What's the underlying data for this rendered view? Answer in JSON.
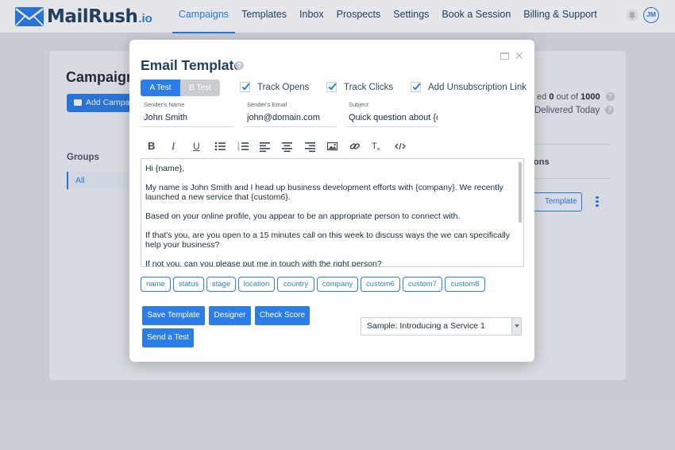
{
  "app": {
    "logo_text": "MailRush",
    "logo_suffix": ".io"
  },
  "nav": {
    "items": [
      {
        "label": "Campaigns",
        "active": true
      },
      {
        "label": "Templates"
      },
      {
        "label": "Inbox"
      },
      {
        "label": "Prospects"
      },
      {
        "label": "Settings"
      },
      {
        "label": "Book a Session"
      },
      {
        "label": "Billing & Support"
      }
    ],
    "avatar_initials": "JM"
  },
  "background": {
    "title": "Campaign",
    "add_button": "Add Campaign",
    "groups_label": "Groups",
    "groups_all": "All",
    "stat_prefix": "ed",
    "stat_value": "0",
    "stat_suffix": "out of",
    "stat_total": "1000",
    "delivered_label": "Delivered Today",
    "table_header": "ons",
    "template_button": "Template"
  },
  "modal": {
    "title": "Email Template",
    "ab_tabs": {
      "a": "A Test",
      "b": "B Test"
    },
    "checkboxes": {
      "track_opens": {
        "label": "Track Opens",
        "checked": true
      },
      "track_clicks": {
        "label": "Track Clicks",
        "checked": true
      },
      "unsub_link": {
        "label": "Add Unsubscription Link",
        "checked": true
      }
    },
    "fields": {
      "sender_name": {
        "label": "Sender's Name",
        "value": "John Smith"
      },
      "sender_email": {
        "label": "Sender's Email",
        "value": "john@domain.com"
      },
      "subject": {
        "label": "Subject",
        "value": "Quick question about {company}"
      }
    },
    "toolbar": {
      "bold": "B",
      "italic": "I",
      "underline": "U",
      "clear_format": "T"
    },
    "body": {
      "line1": "Hi {name},",
      "line2": "My name is John Smith and I head up business development efforts with {company}. We recently launched a new service that {custom6}.",
      "line3": "Based on your online profile, you appear to be an appropriate person to connect with.",
      "line4": "If that's you, are you open to a 15 minutes call on this week to discuss ways the we can specifically help your business?",
      "line5": "If not you, can you please put me in touch with the right person?"
    },
    "tags": [
      "name",
      "status",
      "stage",
      "location",
      "country",
      "company",
      "custom6",
      "custom7",
      "custom8"
    ],
    "buttons": {
      "save": "Save Template",
      "designer": "Designer",
      "check": "Check Score",
      "send_test": "Send a Test"
    },
    "sample_select": "Sample: Introducing a Service 1"
  },
  "colors": {
    "accent": "#2b7de9",
    "brand_dark": "#23415f"
  }
}
